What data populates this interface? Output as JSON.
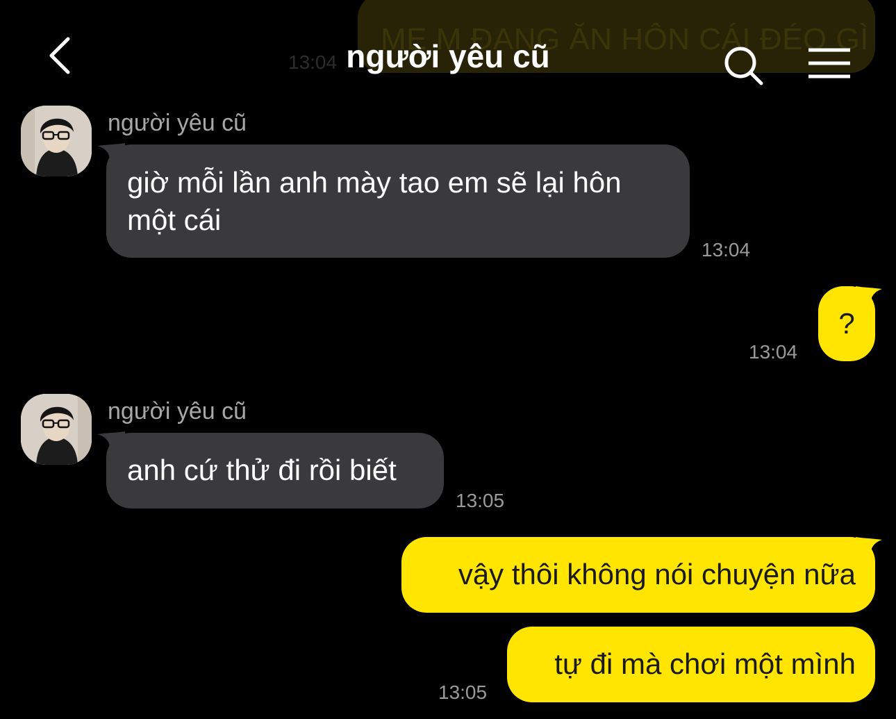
{
  "header": {
    "title": "người yêu cũ"
  },
  "previous": {
    "text": "MẸ M ĐANG ĂN HÔN CÁI ĐÉO GÌ",
    "time": "13:04"
  },
  "messages": [
    {
      "sender": "người yêu cũ",
      "text_line1": "giờ mỗi lần anh mày tao em sẽ lại hôn",
      "text_line2": "một cái",
      "time": "13:04"
    },
    {
      "text": "?",
      "time": "13:04"
    },
    {
      "sender": "người yêu cũ",
      "text": "anh cứ thử đi rồi biết",
      "time": "13:05"
    },
    {
      "text": "vậy thôi không nói chuyện nữa"
    },
    {
      "text": "tự đi mà chơi một mình",
      "time": "13:05"
    }
  ],
  "colors": {
    "background": "#000000",
    "incoming_bubble": "#3a3a3c",
    "outgoing_bubble": "#ffe500",
    "timestamp": "#9a9a9a"
  }
}
